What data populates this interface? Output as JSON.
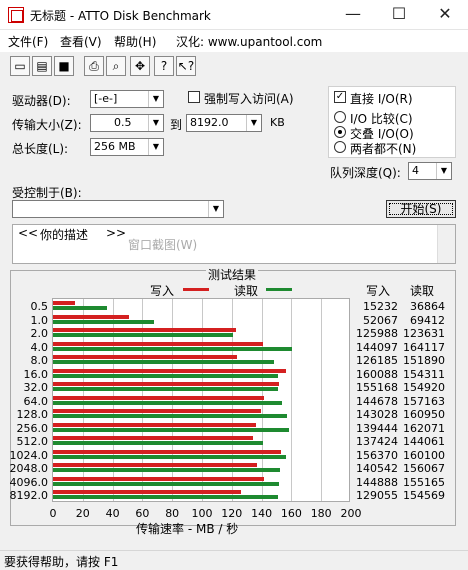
{
  "window": {
    "title": "无标题 - ATTO Disk Benchmark",
    "min": "—",
    "max": "☐",
    "close": "✕"
  },
  "menu": {
    "file": "文件(F)",
    "view": "查看(V)",
    "help": "帮助(H)",
    "localized": "汉化: www.upantool.com"
  },
  "toolbar": [
    "new-icon",
    "open-icon",
    "save-icon",
    "print-icon",
    "preview-icon",
    "move-icon",
    "help-icon",
    "context-help-icon"
  ],
  "form": {
    "drive_label": "驱动器(D):",
    "drive_value": "[-e-]",
    "force_write_label": "强制写入访问(A)",
    "force_write_checked": false,
    "direct_io_label": "直接 I/O(R)",
    "direct_io_checked": true,
    "transfer_label": "传输大小(Z):",
    "transfer_from": "0.5",
    "to_label": "到",
    "transfer_to": "8192.0",
    "unit": "KB",
    "total_label": "总长度(L):",
    "total_value": "256 MB",
    "io_compare": "I/O 比较(C)",
    "io_overlap": "交叠 I/O(O)",
    "io_neither": "两者都不(N)",
    "queue_label": "队列深度(Q):",
    "queue_value": "4",
    "controlled_label": "受控制于(B):",
    "controlled_value": "",
    "start_button": "开始(S)",
    "desc_open": "<<",
    "desc_text": "你的描述",
    "desc_close": ">>",
    "desc_ghost": "窗口截图(W)"
  },
  "results": {
    "title": "测试结果",
    "legend_write": "写入",
    "legend_read": "读取",
    "col_write": "写入",
    "col_read": "读取",
    "xlabel": "传输速率 - MB / 秒",
    "colors": {
      "write": "#d42020",
      "read": "#1e8a30"
    }
  },
  "chart_data": {
    "type": "bar",
    "categories": [
      "0.5",
      "1.0",
      "2.0",
      "4.0",
      "8.0",
      "16.0",
      "32.0",
      "64.0",
      "128.0",
      "256.0",
      "512.0",
      "1024.0",
      "2048.0",
      "4096.0",
      "8192.0"
    ],
    "series": [
      {
        "name": "写入",
        "values": [
          15232,
          52067,
          125988,
          144097,
          126185,
          160088,
          155168,
          144678,
          143028,
          139444,
          137424,
          156370,
          140542,
          144888,
          129055
        ]
      },
      {
        "name": "读取",
        "values": [
          36864,
          69412,
          123631,
          164117,
          151890,
          154311,
          154920,
          157163,
          160950,
          162071,
          144061,
          160100,
          156067,
          155165,
          154569
        ]
      }
    ],
    "xticks": [
      "0",
      "20",
      "40",
      "60",
      "80",
      "100",
      "120",
      "140",
      "160",
      "180",
      "200"
    ],
    "xlim": [
      0,
      200
    ],
    "value_unit": "KB/s"
  },
  "status": "要获得帮助，请按 F1"
}
